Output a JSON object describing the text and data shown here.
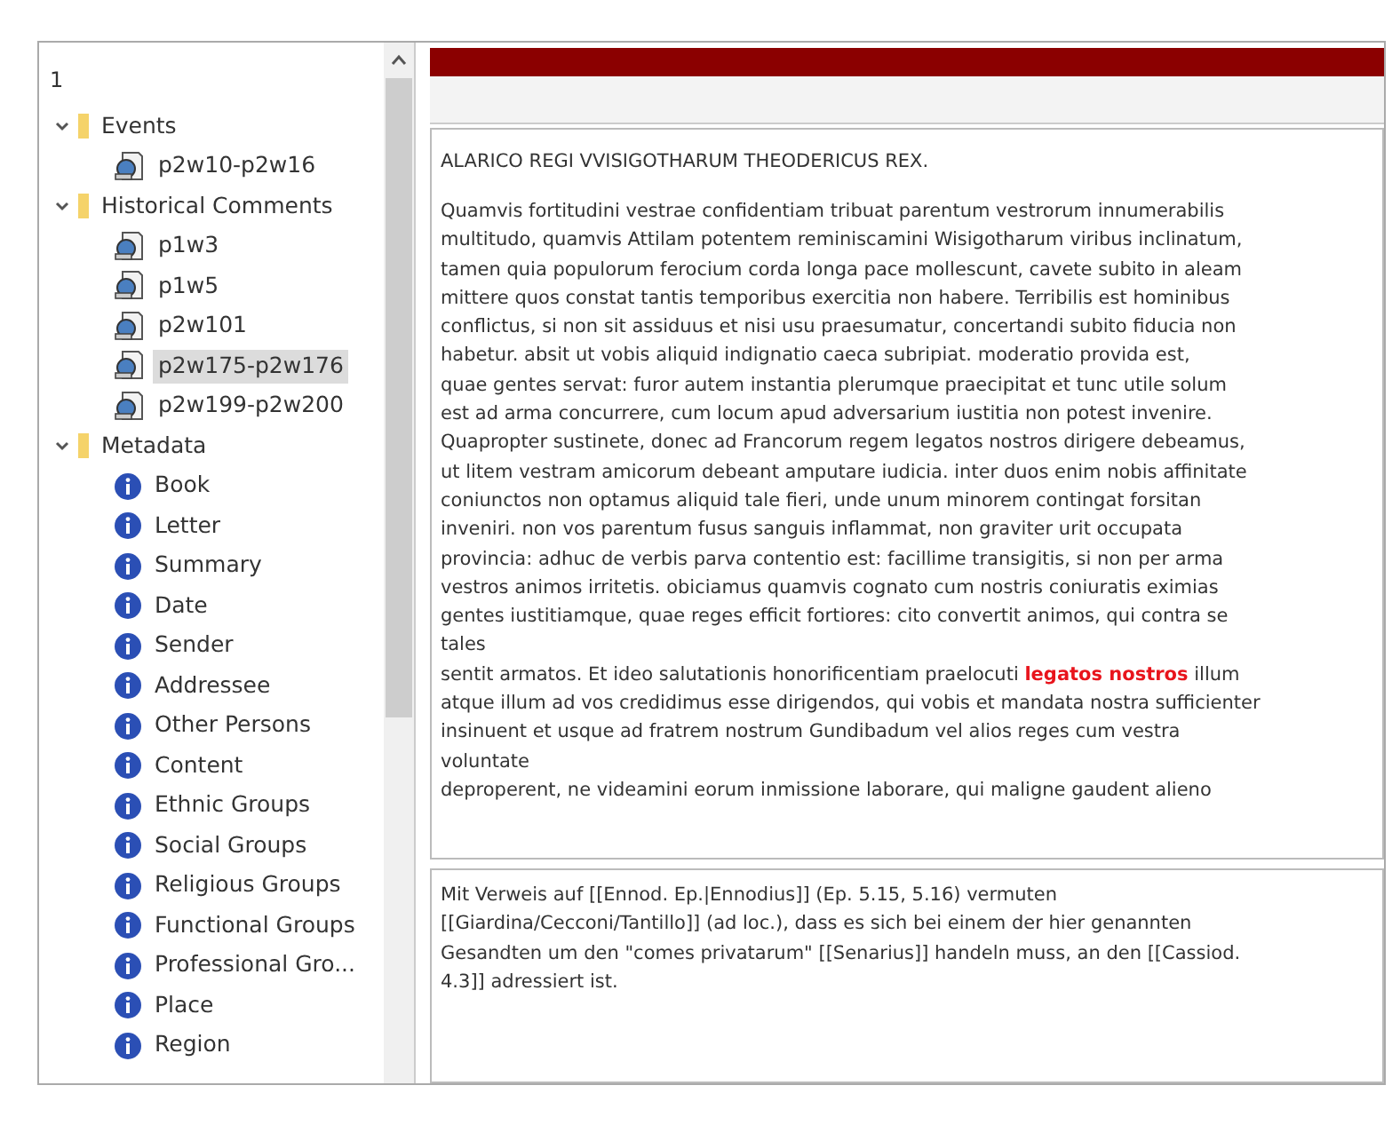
{
  "tree": {
    "header": "1",
    "items": [
      {
        "label": "Events",
        "kind": "folder",
        "expanded": true,
        "children": [
          {
            "label": "p2w10-p2w16",
            "kind": "document",
            "selected": false
          }
        ]
      },
      {
        "label": "Historical Comments",
        "kind": "folder",
        "expanded": true,
        "children": [
          {
            "label": "p1w3",
            "kind": "document",
            "selected": false
          },
          {
            "label": "p1w5",
            "kind": "document",
            "selected": false
          },
          {
            "label": "p2w101",
            "kind": "document",
            "selected": false
          },
          {
            "label": "p2w175-p2w176",
            "kind": "document",
            "selected": true
          },
          {
            "label": "p2w199-p2w200",
            "kind": "document",
            "selected": false
          }
        ]
      },
      {
        "label": "Metadata",
        "kind": "folder",
        "expanded": true,
        "children": [
          {
            "label": "Book",
            "kind": "info",
            "selected": false
          },
          {
            "label": "Letter",
            "kind": "info",
            "selected": false
          },
          {
            "label": "Summary",
            "kind": "info",
            "selected": false
          },
          {
            "label": "Date",
            "kind": "info",
            "selected": false
          },
          {
            "label": "Sender",
            "kind": "info",
            "selected": false
          },
          {
            "label": "Addressee",
            "kind": "info",
            "selected": false
          },
          {
            "label": "Other Persons",
            "kind": "info",
            "selected": false
          },
          {
            "label": "Content",
            "kind": "info",
            "selected": false
          },
          {
            "label": "Ethnic Groups",
            "kind": "info",
            "selected": false
          },
          {
            "label": "Social Groups",
            "kind": "info",
            "selected": false
          },
          {
            "label": "Religious Groups",
            "kind": "info",
            "selected": false
          },
          {
            "label": "Functional Groups",
            "kind": "info",
            "selected": false
          },
          {
            "label": "Professional Gro...",
            "kind": "info",
            "selected": false
          },
          {
            "label": "Place",
            "kind": "info",
            "selected": false
          },
          {
            "label": "Region",
            "kind": "info",
            "selected": false
          }
        ]
      }
    ]
  },
  "document": {
    "title": "ALARICO REGI VVISIGOTHARUM THEODERICUS REX.",
    "lines": [
      [
        {
          "text": "Quamvis fortitudini vestrae confidentiam tribuat parentum vestrorum innumerabilis",
          "kind": "plain"
        }
      ],
      [
        {
          "text": "multitudo, quamvis Attilam potentem reminiscamini Wisigotharum viribus inclinatum,",
          "kind": "plain"
        }
      ],
      [
        {
          "text": "tamen quia populorum ferocium corda longa pace mollescunt, cavete subito in aleam",
          "kind": "plain"
        }
      ],
      [
        {
          "text": "mittere quos constat tantis temporibus exercitia non habere. Terribilis est hominibus",
          "kind": "plain"
        }
      ],
      [
        {
          "text": "conflictus, si non sit assiduus et nisi usu praesumatur, concertandi subito fiducia non",
          "kind": "plain"
        }
      ],
      [
        {
          "text": "habetur. absit ut vobis aliquid indignatio caeca subripiat. moderatio provida est,",
          "kind": "plain"
        }
      ],
      [
        {
          "text": "quae gentes servat: furor autem instantia plerumque praecipitat et tunc utile solum",
          "kind": "plain"
        }
      ],
      [
        {
          "text": "est ad arma concurrere, cum locum apud adversarium iustitia non potest invenire.",
          "kind": "plain"
        }
      ],
      [
        {
          "text": "Quapropter sustinete, donec ad Francorum regem legatos nostros dirigere debeamus,",
          "kind": "plain"
        }
      ],
      [
        {
          "text": "ut litem vestram amicorum debeant amputare iudicia. inter duos enim nobis affinitate",
          "kind": "plain"
        }
      ],
      [
        {
          "text": "coniunctos non optamus aliquid tale fieri, unde unum minorem contingat forsitan",
          "kind": "plain"
        }
      ],
      [
        {
          "text": "inveniri. non vos parentum fusus sanguis inflammat, non graviter urit occupata",
          "kind": "plain"
        }
      ],
      [
        {
          "text": "provincia: adhuc de verbis parva contentio est: facillime transigitis, si non per arma",
          "kind": "plain"
        }
      ],
      [
        {
          "text": "vestros animos irritetis. obiciamus quamvis cognato cum nostris coniuratis eximias",
          "kind": "plain"
        }
      ],
      [
        {
          "text": "gentes iustitiamque, quae reges efficit fortiores: cito convertit animos, qui contra se",
          "kind": "plain"
        }
      ],
      [
        {
          "text": "tales",
          "kind": "plain"
        }
      ],
      [
        {
          "text": "sentit armatos. Et ideo salutationis honorificentiam praelocuti ",
          "kind": "plain"
        },
        {
          "text": "legatos nostros",
          "kind": "highlight"
        },
        {
          "text": " illum",
          "kind": "plain"
        }
      ],
      [
        {
          "text": "atque illum ad vos credidimus esse dirigendos, qui vobis et mandata nostra sufficienter",
          "kind": "plain"
        }
      ],
      [
        {
          "text": "insinuent et usque ad fratrem nostrum Gundibadum vel alios reges cum vestra",
          "kind": "plain"
        }
      ],
      [
        {
          "text": "voluntate",
          "kind": "plain"
        }
      ],
      [
        {
          "text": "deproperent, ne videamini eorum inmissione laborare, qui maligne gaudent alieno",
          "kind": "plain"
        }
      ]
    ]
  },
  "comment": {
    "lines": [
      "Mit Verweis auf [[Ennod. Ep.|Ennodius]] (Ep. 5.15, 5.16) vermuten",
      "[[Giardina/Cecconi/Tantillo]] (ad loc.), dass es sich bei einem der hier genannten",
      "Gesandten um den \"comes privatarum\" [[Senarius]] handeln muss, an den [[Cassiod.",
      "4.3]] adressiert ist."
    ]
  }
}
